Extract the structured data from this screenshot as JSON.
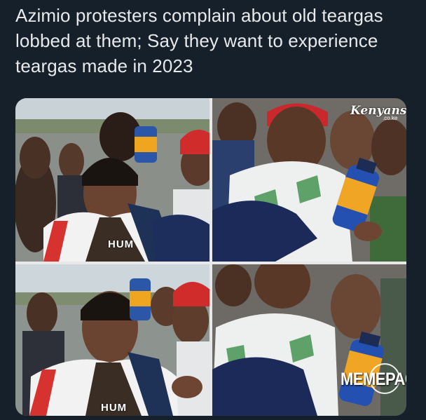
{
  "post": {
    "text": "Azimio protesters complain about old teargas lobbed at them; Say they want to experience teargas made in 2023"
  },
  "media": {
    "watermark_top": "Kenyans",
    "watermark_top_sub": ".co.ke",
    "watermark_bottom": "MEMEPACT",
    "shirt_text": "HUM"
  },
  "colors": {
    "background": "#15202b",
    "text": "#e7e9ea"
  }
}
